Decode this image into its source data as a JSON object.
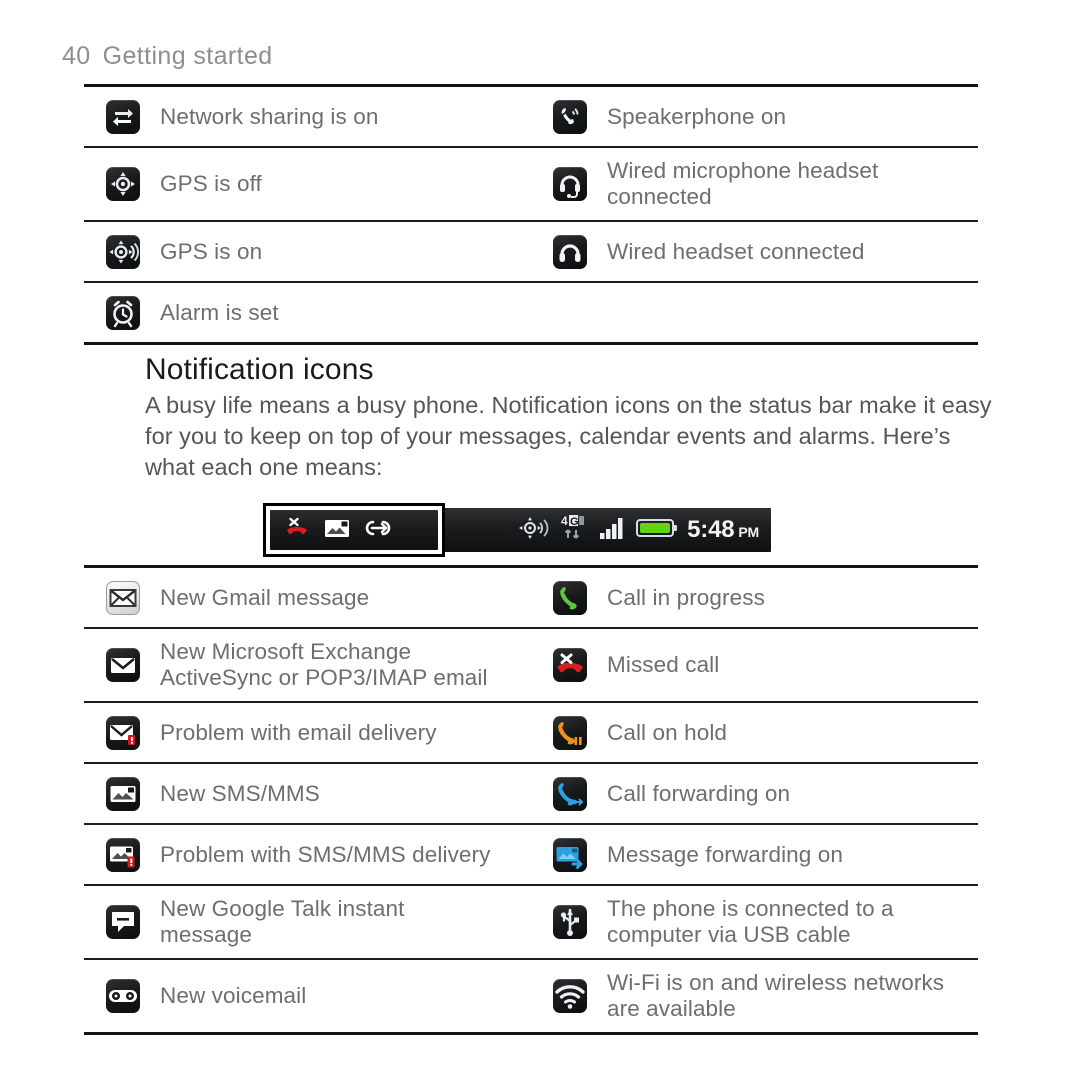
{
  "header": {
    "page_number": "40",
    "title": "Getting started"
  },
  "status_icons_table": {
    "rows": [
      {
        "left": {
          "icon": "network-sharing-icon",
          "label": "Network sharing is on"
        },
        "right": {
          "icon": "speakerphone-icon",
          "label": "Speakerphone on"
        }
      },
      {
        "left": {
          "icon": "gps-off-icon",
          "label": "GPS is off"
        },
        "right": {
          "icon": "wired-microphone-headset-icon",
          "label": "Wired microphone headset\nconnected"
        }
      },
      {
        "left": {
          "icon": "gps-on-icon",
          "label": "GPS is on"
        },
        "right": {
          "icon": "wired-headset-icon",
          "label": "Wired headset connected"
        }
      },
      {
        "left": {
          "icon": "alarm-icon",
          "label": "Alarm is set"
        },
        "right": {
          "icon": "",
          "label": ""
        }
      }
    ]
  },
  "section": {
    "heading": "Notification icons",
    "body": "A busy life means a busy phone. Notification icons on the status bar make it easy for you to keep on top of your messages, calendar events and alarms. Here’s what each one means:"
  },
  "statusbar_figure": {
    "highlight_icons": [
      "missed-call-icon",
      "new-mms-icon",
      "link-icon"
    ],
    "right_icons": [
      "gps-icon",
      "4g-data-icon",
      "signal-bars-icon",
      "battery-icon"
    ],
    "network_label": "4G",
    "time": "5:48",
    "am_pm": "PM",
    "battery_color": "#62d411"
  },
  "notification_icons_table": {
    "rows": [
      {
        "left": {
          "icon": "gmail-icon",
          "label": "New Gmail message"
        },
        "right": {
          "icon": "call-in-progress-icon",
          "label": "Call in progress"
        }
      },
      {
        "left": {
          "icon": "email-icon",
          "label": "New Microsoft Exchange\nActiveSync or POP3/IMAP email"
        },
        "right": {
          "icon": "missed-call-icon",
          "label": "Missed call"
        }
      },
      {
        "left": {
          "icon": "email-problem-icon",
          "label": "Problem with email delivery"
        },
        "right": {
          "icon": "call-on-hold-icon",
          "label": "Call on hold"
        }
      },
      {
        "left": {
          "icon": "new-sms-mms-icon",
          "label": "New SMS/MMS"
        },
        "right": {
          "icon": "call-forwarding-icon",
          "label": "Call forwarding on"
        }
      },
      {
        "left": {
          "icon": "sms-mms-problem-icon",
          "label": "Problem with SMS/MMS delivery"
        },
        "right": {
          "icon": "message-forwarding-icon",
          "label": "Message forwarding on"
        }
      },
      {
        "left": {
          "icon": "google-talk-icon",
          "label": "New Google Talk instant\nmessage"
        },
        "right": {
          "icon": "usb-icon",
          "label": "The phone is connected to a\ncomputer via USB cable"
        }
      },
      {
        "left": {
          "icon": "voicemail-icon",
          "label": "New voicemail"
        },
        "right": {
          "icon": "wifi-icon",
          "label": "Wi-Fi is on and wireless networks\nare available"
        }
      }
    ]
  },
  "colors": {
    "rule": "#141414",
    "body_text": "#565656",
    "heading_text": "#1b1b1b",
    "header_text": "#8e8e8e",
    "call_green": "#5ec63b",
    "call_red": "#d81f1f",
    "call_orange": "#f0921a",
    "call_blue": "#2f9fe0"
  }
}
